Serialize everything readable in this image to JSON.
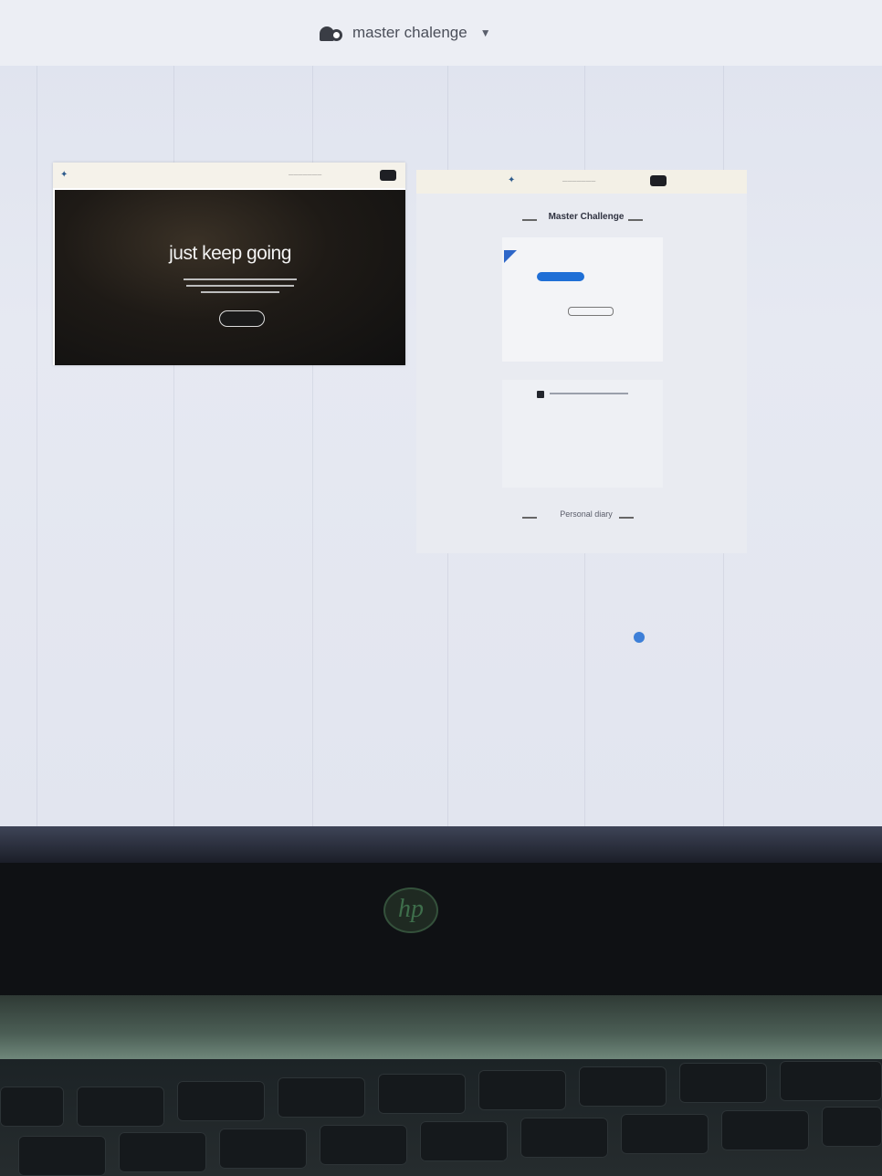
{
  "topbar": {
    "project_name": "master chalenge",
    "logo_icon": "cloud-logo-icon",
    "dropdown_icon": "chevron-down-icon"
  },
  "left_card": {
    "hero_title": "just keep going"
  },
  "right_card": {
    "section1_title": "Master Challenge",
    "section2_title": "Personal diary"
  },
  "laptop": {
    "brand": "hp"
  },
  "colors": {
    "accent": "#1f6fd6",
    "screen_bg": "#e2e5ef",
    "hero_bg": "#1e1a16"
  }
}
